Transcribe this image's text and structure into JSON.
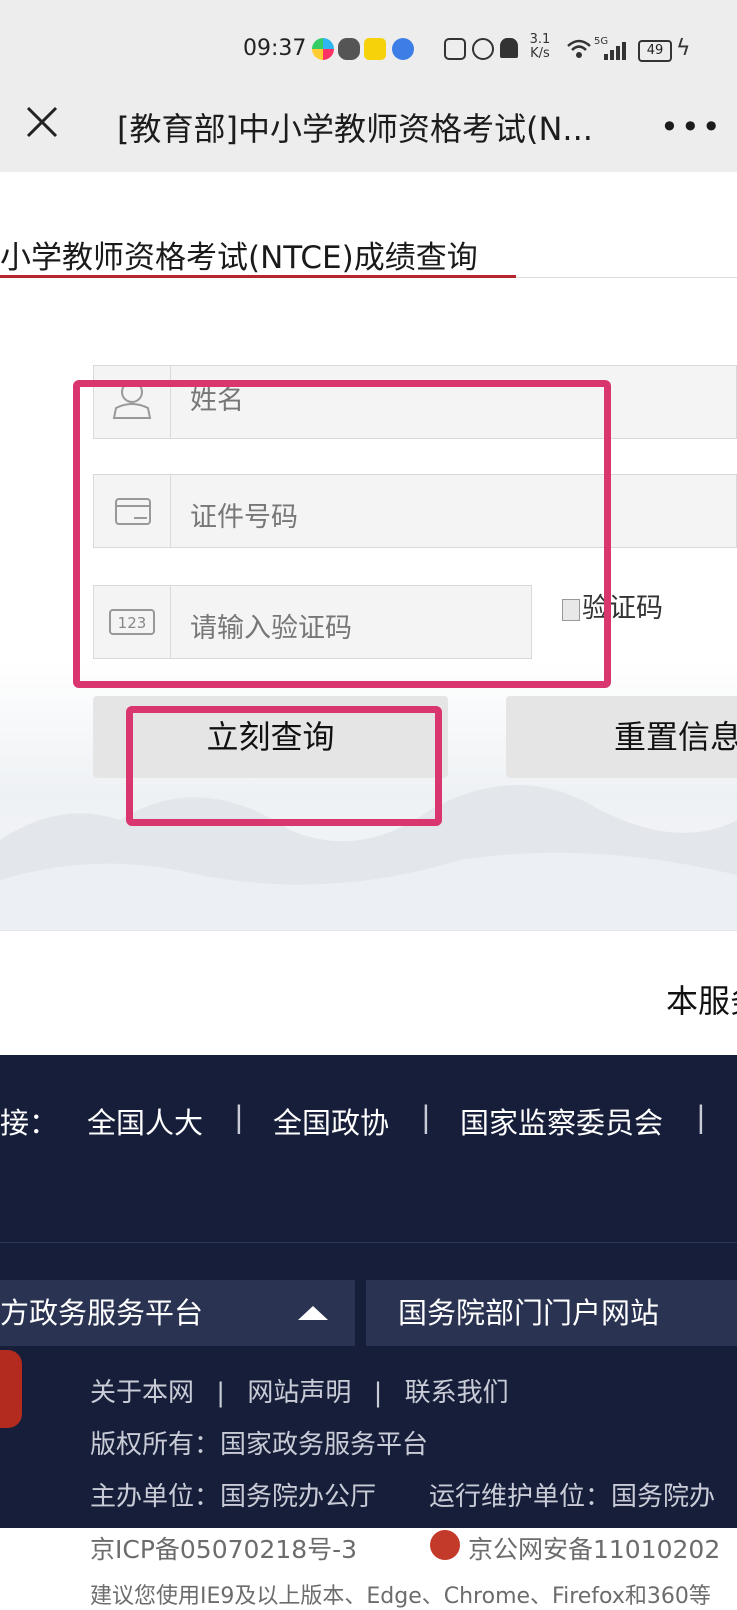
{
  "status_bar": {
    "time": "09:37",
    "net_speed_value": "3.1",
    "net_speed_unit": "K/s",
    "signal": "5G",
    "battery": "49"
  },
  "window": {
    "title": "[教育部]中小学教师资格考试(N..."
  },
  "page": {
    "subject": "小学教师资格考试(NTCE)成绩查询"
  },
  "form": {
    "name_placeholder": "姓名",
    "id_placeholder": "证件号码",
    "captcha_placeholder": "请输入验证码",
    "captcha_image_alt": "验证码",
    "submit_label": "立刻查询",
    "reset_label": "重置信息"
  },
  "service_text": "本服务",
  "footer": {
    "links_prefix": "接：",
    "links": [
      "全国人大",
      "全国政协",
      "国家监察委员会"
    ],
    "link_separator": "|",
    "dropdown_left": "方政务服务平台",
    "dropdown_right": "国务院部门门户网站",
    "about": [
      "关于本网",
      "网站声明",
      "联系我们"
    ],
    "copyright": "版权所有：国家政务服务平台",
    "sponsor": "主办单位：国务院办公厅",
    "operator": "运行维护单位：国务院办",
    "icp": "京ICP备05070218号-3",
    "police_record": "京公网安备11010202",
    "browser_tip": "建议您使用IE9及以上版本、Edge、Chrome、Firefox和360等"
  },
  "colors": {
    "highlight": "#d9356e",
    "footer_bg": "#161e3a",
    "underline": "#b5262f"
  }
}
